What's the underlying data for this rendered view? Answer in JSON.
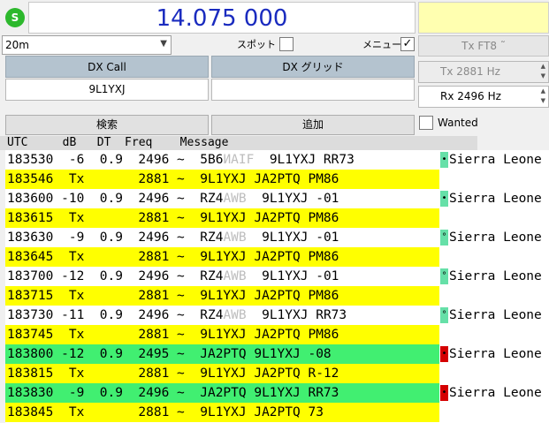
{
  "status_icon": "S",
  "frequency": "14.075 000",
  "band": "20m",
  "spot_label": "スポット",
  "spot_checked": false,
  "menu_label": "メニュー",
  "menu_checked": true,
  "tx_mode": "Tx FT8 ˜",
  "dx_call_label": "DX Call",
  "dx_grid_label": "DX グリッド",
  "dx_call_value": "9L1YXJ",
  "dx_grid_value": "",
  "tx_freq": "Tx  2881  Hz",
  "rx_freq": "Rx  2496  Hz",
  "search_label": "検索",
  "add_label": "追加",
  "wanted_label": "Wanted",
  "wanted_checked": false,
  "col_header": "UTC     dB   DT  Freq    Message",
  "colors": {
    "tx_row": "#ffff00",
    "cq_me_row": "#41ef71",
    "mark_green": "#66e0a8",
    "mark_red": "#d40000"
  },
  "rows": [
    {
      "p1": "183530  -6  0.9  2496 ~  5B6",
      "hidden": "ИAIF",
      "p2": "  9L1YXJ RR73",
      "kind": "rx",
      "mark": "•",
      "mark_color": "green",
      "country": "Sierra Leone"
    },
    {
      "p1": "183546  Tx       2881 ~  9L1YXJ JA2PTQ PM86",
      "hidden": "",
      "p2": "",
      "kind": "tx",
      "mark": "",
      "mark_color": "",
      "country": ""
    },
    {
      "p1": "183600 -10  0.9  2496 ~  RZ4",
      "hidden": "AWB",
      "p2": "  9L1YXJ -01",
      "kind": "rx",
      "mark": "•",
      "mark_color": "green",
      "country": "Sierra Leone"
    },
    {
      "p1": "183615  Tx       2881 ~  9L1YXJ JA2PTQ PM86",
      "hidden": "",
      "p2": "",
      "kind": "tx",
      "mark": "",
      "mark_color": "",
      "country": ""
    },
    {
      "p1": "183630  -9  0.9  2496 ~  RZ4",
      "hidden": "AWB",
      "p2": "  9L1YXJ -01",
      "kind": "rx",
      "mark": "°",
      "mark_color": "green",
      "country": "Sierra Leone"
    },
    {
      "p1": "183645  Tx       2881 ~  9L1YXJ JA2PTQ PM86",
      "hidden": "",
      "p2": "",
      "kind": "tx",
      "mark": "",
      "mark_color": "",
      "country": ""
    },
    {
      "p1": "183700 -12  0.9  2496 ~  RZ4",
      "hidden": "AWB",
      "p2": "  9L1YXJ -01",
      "kind": "rx",
      "mark": "°",
      "mark_color": "green",
      "country": "Sierra Leone"
    },
    {
      "p1": "183715  Tx       2881 ~  9L1YXJ JA2PTQ PM86",
      "hidden": "",
      "p2": "",
      "kind": "tx",
      "mark": "",
      "mark_color": "",
      "country": ""
    },
    {
      "p1": "183730 -11  0.9  2496 ~  RZ4",
      "hidden": "AWB",
      "p2": "  9L1YXJ RR73",
      "kind": "rx",
      "mark": "°",
      "mark_color": "green",
      "country": "Sierra Leone"
    },
    {
      "p1": "183745  Tx       2881 ~  9L1YXJ JA2PTQ PM86",
      "hidden": "",
      "p2": "",
      "kind": "tx",
      "mark": "",
      "mark_color": "",
      "country": ""
    },
    {
      "p1": "183800 -12  0.9  2495 ~  JA2PTQ 9L1YXJ -08",
      "hidden": "",
      "p2": "",
      "kind": "me",
      "mark": "•",
      "mark_color": "red",
      "country": "Sierra Leone"
    },
    {
      "p1": "183815  Tx       2881 ~  9L1YXJ JA2PTQ R-12",
      "hidden": "",
      "p2": "",
      "kind": "tx",
      "mark": "",
      "mark_color": "",
      "country": ""
    },
    {
      "p1": "183830  -9  0.9  2496 ~  JA2PTQ 9L1YXJ RR73",
      "hidden": "",
      "p2": "",
      "kind": "me",
      "mark": "•",
      "mark_color": "red",
      "country": "Sierra Leone"
    },
    {
      "p1": "183845  Tx       2881 ~  9L1YXJ JA2PTQ 73",
      "hidden": "",
      "p2": "",
      "kind": "tx",
      "mark": "",
      "mark_color": "",
      "country": ""
    }
  ]
}
